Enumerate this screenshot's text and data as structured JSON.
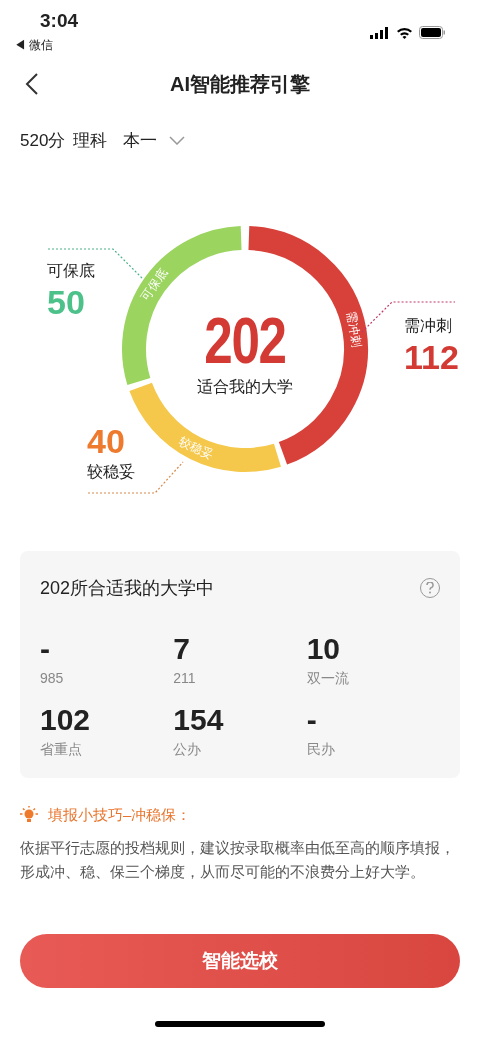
{
  "status_bar": {
    "time": "3:04",
    "back_app": "◀ 微信"
  },
  "nav": {
    "title": "AI智能推荐引擎"
  },
  "filter": {
    "score": "520分",
    "subject": "理科",
    "batch": "本一"
  },
  "donut": {
    "total": "202",
    "caption": "适合我的大学",
    "segments": [
      {
        "kind": "rush",
        "arc_label": "需冲刺",
        "label": "需冲刺",
        "value": "112",
        "color": "#d8403a"
      },
      {
        "kind": "stable",
        "arc_label": "较稳妥",
        "label": "较稳妥",
        "value": "40",
        "color": "#f5c84c"
      },
      {
        "kind": "safe",
        "arc_label": "可保底",
        "label": "可保底",
        "value": "50",
        "color": "#9bd45f"
      }
    ]
  },
  "summary": {
    "title": "202所合适我的大学中",
    "stats": [
      {
        "value": "-",
        "label": "985"
      },
      {
        "value": "7",
        "label": "211"
      },
      {
        "value": "10",
        "label": "双一流"
      },
      {
        "value": "102",
        "label": "省重点"
      },
      {
        "value": "154",
        "label": "公办"
      },
      {
        "value": "-",
        "label": "民办"
      }
    ]
  },
  "tip": {
    "title": "填报小技巧–冲稳保：",
    "text": "依据平行志愿的投档规则，建议按录取概率由低至高的顺序填报，形成冲、稳、保三个梯度，从而尽可能的不浪费分上好大学。"
  },
  "action": {
    "label": "智能选校"
  }
}
